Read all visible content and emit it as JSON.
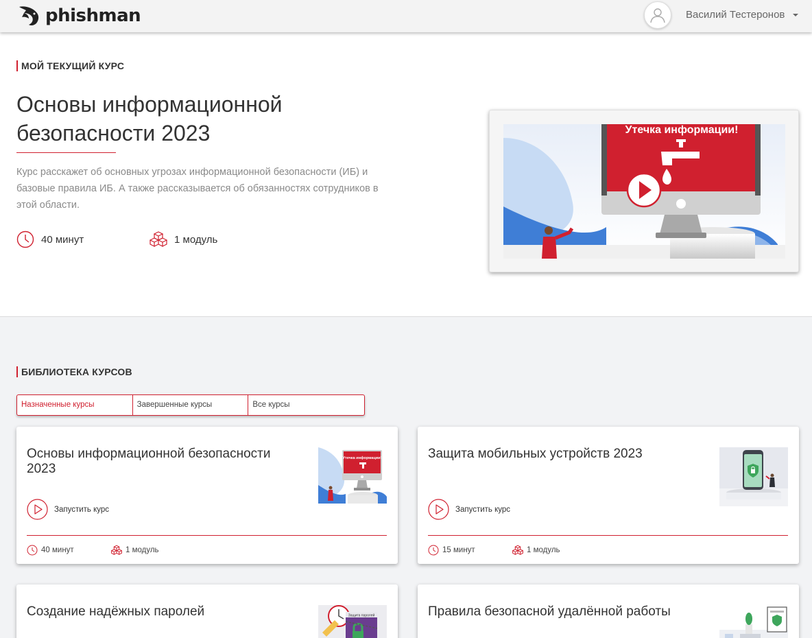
{
  "header": {
    "logo_text": "phishman",
    "user_name": "Василий Тестеронов"
  },
  "current": {
    "label": "МОЙ ТЕКУЩИЙ КУРС",
    "title": "Основы информационной безопасности 2023",
    "description": "Курс расскажет об основных угрозах информационной безопасности (ИБ) и базовые правила ИБ. А также рассказывается об обязанностях сотрудников в этой области.",
    "duration": "40 минут",
    "modules": "1 модуль",
    "video_caption": "Утечка информации!"
  },
  "library": {
    "label": "БИБЛИОТЕКА КУРСОВ",
    "tabs": [
      "Назначенные курсы",
      "Завершенные курсы",
      "Все курсы"
    ],
    "launch_label": "Запустить курс",
    "courses": [
      {
        "title": "Основы информационной безопасности 2023",
        "duration": "40 минут",
        "modules": "1 модуль",
        "thumb_caption": "Утечка информации!"
      },
      {
        "title": "Защита мобильных устройств 2023",
        "duration": "15 минут",
        "modules": "1 модуль"
      },
      {
        "title": "Создание надёжных паролей",
        "thumb_caption": "Защита паролей"
      },
      {
        "title": "Правила безопасной удалённой работы"
      }
    ]
  },
  "colors": {
    "accent": "#d0202f",
    "background": "#f2f3f5",
    "card": "#ffffff"
  },
  "icons": {
    "clock": "clock-icon",
    "modules": "cubes-icon",
    "play": "play-circle-icon",
    "avatar": "user-avatar-icon",
    "caret": "caret-down-icon"
  }
}
